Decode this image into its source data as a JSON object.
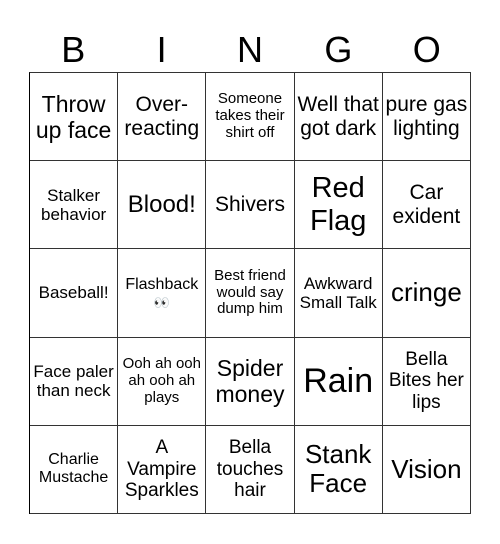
{
  "header": {
    "letters": [
      "B",
      "I",
      "N",
      "G",
      "O"
    ]
  },
  "cells": [
    "Throw up face",
    "Over-reacting",
    "Someone takes their shirt off",
    "Well that got dark",
    "pure gas lighting",
    "Stalker behavior",
    "Blood!",
    "Shivers",
    "Red Flag",
    "Car exident",
    "Baseball!",
    "Flashback",
    "Best friend would say dump him",
    "Awkward Small Talk",
    "cringe",
    "Face paler than neck",
    "Ooh ah ooh ah ooh ah plays",
    "Spider money",
    "Rain",
    "Bella Bites her lips",
    "Charlie Mustache",
    "A Vampire Sparkles",
    "Bella touches hair",
    "Stank Face",
    "Vision"
  ],
  "flashback_emoji": "👀"
}
